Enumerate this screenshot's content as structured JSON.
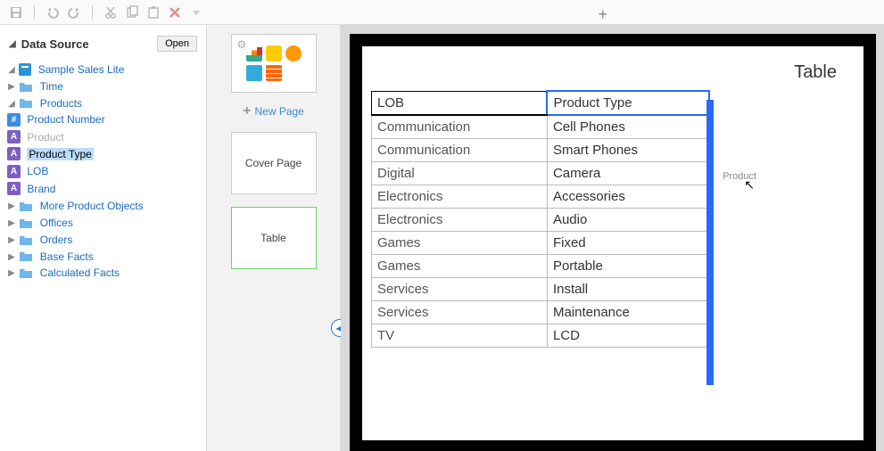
{
  "toolbar": {
    "save": "save-icon",
    "undo": "undo-icon",
    "redo": "redo-icon",
    "cut": "cut-icon",
    "copy": "copy-icon",
    "paste": "paste-icon",
    "delete": "delete-icon"
  },
  "ds_header": {
    "title": "Data Source",
    "open_label": "Open"
  },
  "tree": {
    "root": "Sample Sales Lite",
    "time": "Time",
    "products": "Products",
    "product_number": "Product Number",
    "product": "Product",
    "product_type": "Product Type",
    "lob": "LOB",
    "brand": "Brand",
    "more_products": "More Product Objects",
    "offices": "Offices",
    "orders": "Orders",
    "base_facts": "Base Facts",
    "calc_facts": "Calculated Facts"
  },
  "pagestrip": {
    "new_page": "New Page",
    "cover": "Cover Page",
    "table": "Table"
  },
  "canvas": {
    "page_title": "Table",
    "drag_hint": "Product",
    "chart_data": {
      "type": "table",
      "columns": [
        "LOB",
        "Product Type"
      ],
      "rows": [
        [
          "Communication",
          "Cell Phones"
        ],
        [
          "Communication",
          "Smart Phones"
        ],
        [
          "Digital",
          "Camera"
        ],
        [
          "Electronics",
          "Accessories"
        ],
        [
          "Electronics",
          "Audio"
        ],
        [
          "Games",
          "Fixed"
        ],
        [
          "Games",
          "Portable"
        ],
        [
          "Services",
          "Install"
        ],
        [
          "Services",
          "Maintenance"
        ],
        [
          "TV",
          "LCD"
        ]
      ]
    }
  }
}
